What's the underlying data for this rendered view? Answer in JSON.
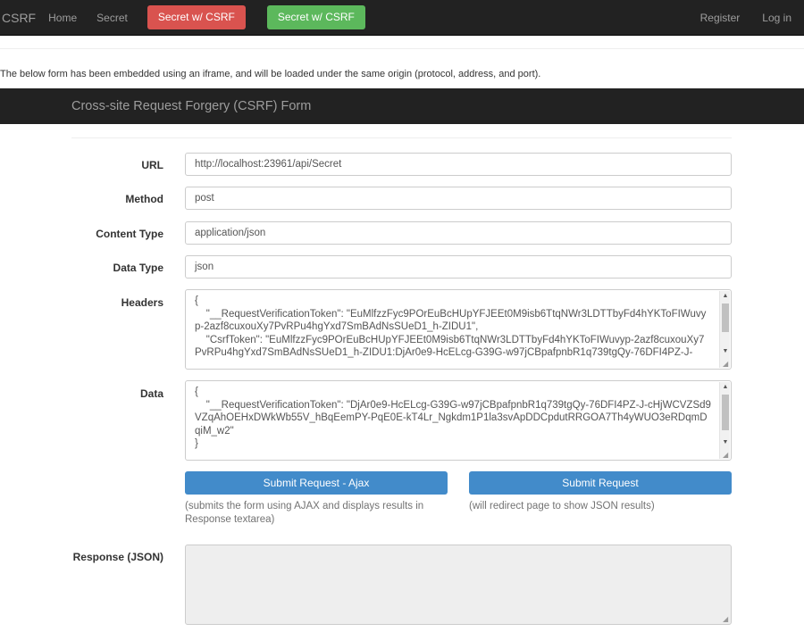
{
  "nav": {
    "brand": "CSRF",
    "links": [
      "Home",
      "Secret"
    ],
    "secret_csrf_red": "Secret w/ CSRF",
    "secret_csrf_green": "Secret w/ CSRF",
    "register": "Register",
    "login": "Log in"
  },
  "intro": "The below form has been embedded using an iframe, and will be loaded under the same origin (protocol, address, and port).",
  "form": {
    "title": "Cross-site Request Forgery (CSRF) Form",
    "url_label": "URL",
    "url_value": "http://localhost:23961/api/Secret",
    "method_label": "Method",
    "method_value": "post",
    "content_type_label": "Content Type",
    "content_type_value": "application/json",
    "data_type_label": "Data Type",
    "data_type_value": "json",
    "headers_label": "Headers",
    "headers_lines": [
      "{",
      "    \"__RequestVerificationToken\": \"EuMlfzzFyc9POrEuBcHUpYFJEEt0M9isb6TtqNWr3LDTTbyFd4hYKToFIWuvyp-2azf8cuxouXy7PvRPu4hgYxd7SmBAdNsSUeD1_h-ZIDU1\",",
      "    \"CsrfToken\": \"EuMlfzzFyc9POrEuBcHUpYFJEEt0M9isb6TtqNWr3LDTTbyFd4hYKToFIWuvyp-2azf8cuxouXy7PvRPu4hgYxd7SmBAdNsSUeD1_h-ZIDU1:DjAr0e9-HcELcg-G39G-w97jCBpafpnbR1q739tgQy-76DFI4PZ-J-"
    ],
    "data_label": "Data",
    "data_lines": [
      "{",
      "    \"__RequestVerificationToken\": \"DjAr0e9-HcELcg-G39G-w97jCBpafpnbR1q739tgQy-76DFI4PZ-J-cHjWCVZSd9VZqAhOEHxDWkWb55V_hBqEemPY-PqE0E-kT4Lr_Ngkdm1P1la3svApDDCpdutRRGOA7Th4yWUO3eRDqmDqiM_w2\"",
      "}"
    ],
    "submit_ajax_label": "Submit Request - Ajax",
    "submit_ajax_help": "(submits the form using AJAX and displays results in Response textarea)",
    "submit_label": "Submit Request",
    "submit_help": "(will redirect page to show JSON results)",
    "response_label": "Response (JSON)",
    "response_value": ""
  },
  "colors": {
    "navbar_bg": "#222222",
    "btn_danger": "#d9534f",
    "btn_success": "#5cb85c",
    "btn_primary": "#428bca"
  },
  "icons": {
    "scroll_up": "scroll-up-arrow-icon",
    "scroll_down": "scroll-down-arrow-icon",
    "resize": "resize-grip-icon"
  }
}
